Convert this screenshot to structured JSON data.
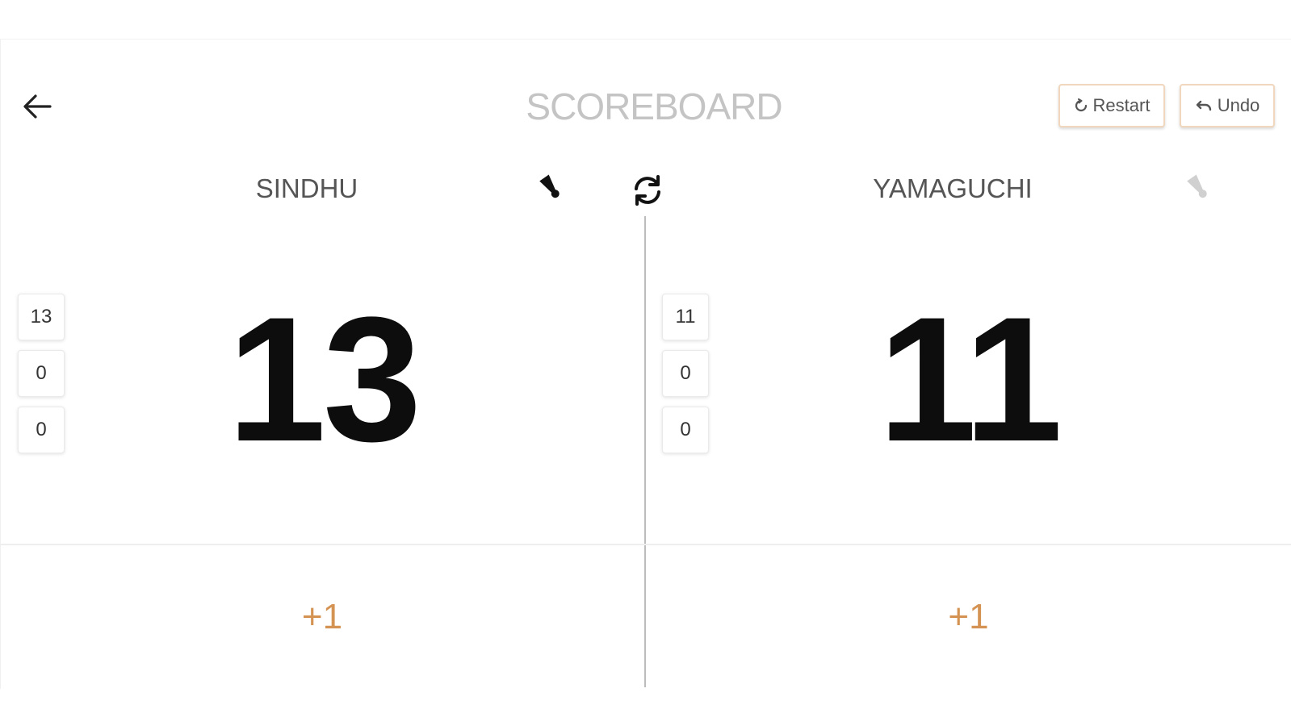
{
  "header": {
    "title": "SCOREBOARD",
    "restart_label": "Restart",
    "undo_label": "Undo"
  },
  "players": {
    "left": {
      "name": "SINDHU",
      "score": "13",
      "sets": [
        "13",
        "0",
        "0"
      ],
      "serving": true,
      "plus_label": "+1"
    },
    "right": {
      "name": "YAMAGUCHI",
      "score": "11",
      "sets": [
        "11",
        "0",
        "0"
      ],
      "serving": false,
      "plus_label": "+1"
    }
  },
  "icons": {
    "back": "arrow-left-icon",
    "restart": "restart-icon",
    "undo": "undo-icon",
    "swap": "swap-sides-icon",
    "shuttle": "shuttlecock-icon"
  },
  "colors": {
    "accent": "#d49352",
    "button_border": "#f0d7bd",
    "title": "#c4c4c4",
    "score": "#0d0d0d",
    "shuttle_active": "#111111",
    "shuttle_inactive": "#d0d0d0"
  }
}
